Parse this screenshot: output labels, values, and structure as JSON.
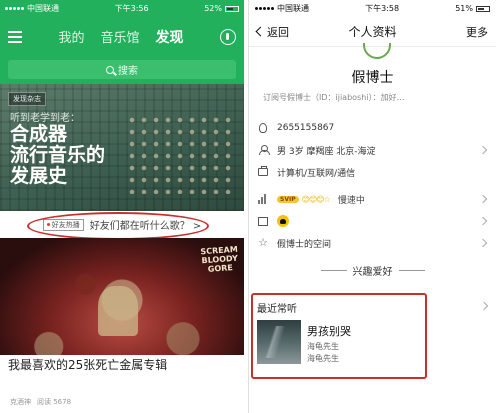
{
  "left": {
    "status": {
      "carrier": "中国联通",
      "time": "下午3:56",
      "battery": "52%"
    },
    "tabs": [
      "我的",
      "音乐馆",
      "发现"
    ],
    "search_placeholder": "搜索",
    "banner": {
      "tag": "发现杂志",
      "subtitle": "听到老学到老：",
      "headline_lines": [
        "合成器",
        "流行音乐的",
        "发展史"
      ]
    },
    "friend_badge": "好友热播",
    "friend_text": "好友们都在听什么歌？ >",
    "album": {
      "logo_lines": [
        "SCREAM",
        "BLOODY",
        "GORE"
      ],
      "caption": "我最喜欢的25张死亡金属专辑"
    },
    "footer": {
      "author": "克酒神",
      "reads": "阅读 5678"
    }
  },
  "right": {
    "status": {
      "carrier": "中国联通",
      "time": "下午3:58",
      "battery": "51%"
    },
    "nav": {
      "back": "返回",
      "title": "个人资料",
      "more": "更多"
    },
    "profile": {
      "name": "假博士",
      "subtitle": "订阅号假博士（ID：ijiaboshi）：加好…"
    },
    "rows": {
      "qq": "2655155867",
      "basic": "男  3岁  摩羯座  北京-海淀",
      "job": "计算机/互联网/通信",
      "svip_badge": "SVIP",
      "emojis": "😊😊😊☆",
      "level_text": "慢速中",
      "space": "假博士的空间"
    },
    "section_title": "兴趣爱好",
    "recent": {
      "label": "最近常听",
      "song": "男孩别哭",
      "artist1": "海龟先生",
      "artist2": "海龟先生"
    }
  }
}
